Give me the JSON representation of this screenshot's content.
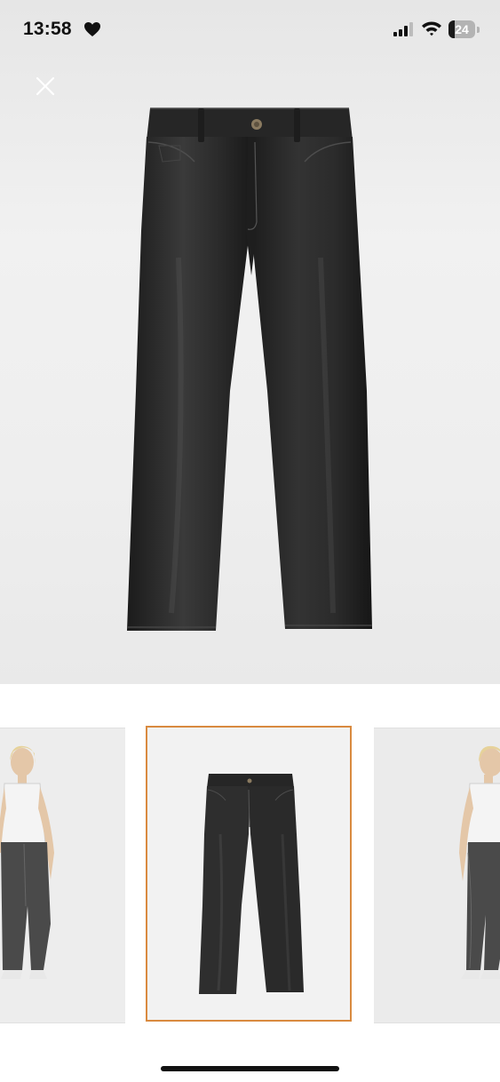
{
  "status_bar": {
    "time": "13:58",
    "battery_level": "24",
    "battery_fraction": 0.24
  },
  "icons": {
    "status": [
      "heart-icon",
      "signal-icon",
      "wifi-icon",
      "battery-icon"
    ],
    "close": "close-icon"
  },
  "gallery": {
    "selected_index": 1,
    "thumbnails": [
      {
        "name": "model-front-view"
      },
      {
        "name": "product-flat-view"
      },
      {
        "name": "model-side-view"
      }
    ]
  },
  "colors": {
    "selected_border": "#d98a3f",
    "hero_background": "#ececec",
    "garment": "#232323"
  }
}
